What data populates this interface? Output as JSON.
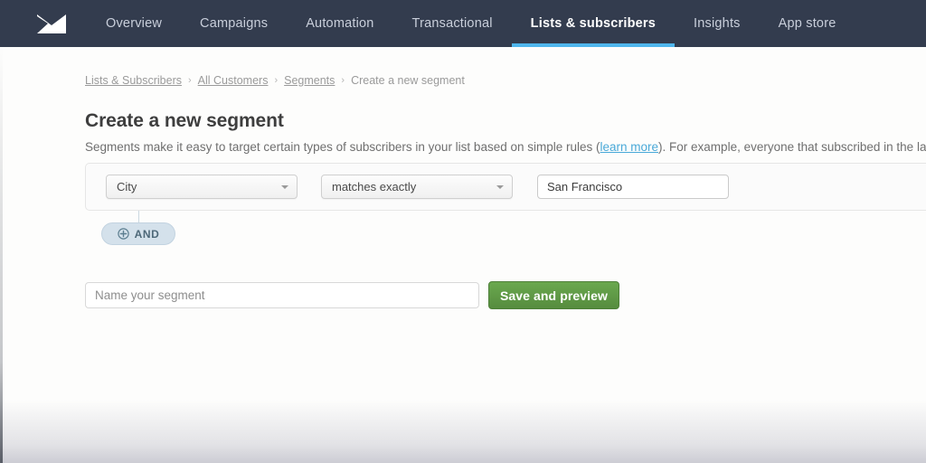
{
  "navbar": {
    "logo_icon": "envelope-logo-icon",
    "items": [
      {
        "label": "Overview",
        "active": false
      },
      {
        "label": "Campaigns",
        "active": false
      },
      {
        "label": "Automation",
        "active": false
      },
      {
        "label": "Transactional",
        "active": false
      },
      {
        "label": "Lists & subscribers",
        "active": true
      },
      {
        "label": "Insights",
        "active": false
      },
      {
        "label": "App store",
        "active": false
      }
    ],
    "accent_color": "#4fb6ec",
    "background_color": "#333c4e"
  },
  "breadcrumb": {
    "separator": "›",
    "items": [
      {
        "label": "Lists & Subscribers",
        "link": true
      },
      {
        "label": "All Customers",
        "link": true
      },
      {
        "label": "Segments",
        "link": true
      },
      {
        "label": "Create a new segment",
        "link": false
      }
    ]
  },
  "main": {
    "title": "Create a new segment",
    "description_part1": "Segments make it easy to target certain types of subscribers in your list based on simple rules (",
    "description_link": "learn more",
    "description_part2": "). For example, everyone that subscribed in the last month, or just males",
    "link_color": "#49a9d8"
  },
  "rule": {
    "attribute_value": "City",
    "operator_value": "matches exactly",
    "value_text": "San Francisco",
    "value_placeholder": "",
    "caret_icon": "chevron-down-icon"
  },
  "and_button": {
    "label": "AND",
    "icon": "plus-circle-icon",
    "background_color": "#d4e1eb",
    "text_color": "#4d6878"
  },
  "name_row": {
    "placeholder": "Name your segment",
    "value": "",
    "save_label": "Save and preview",
    "save_color": "#5a9440"
  }
}
